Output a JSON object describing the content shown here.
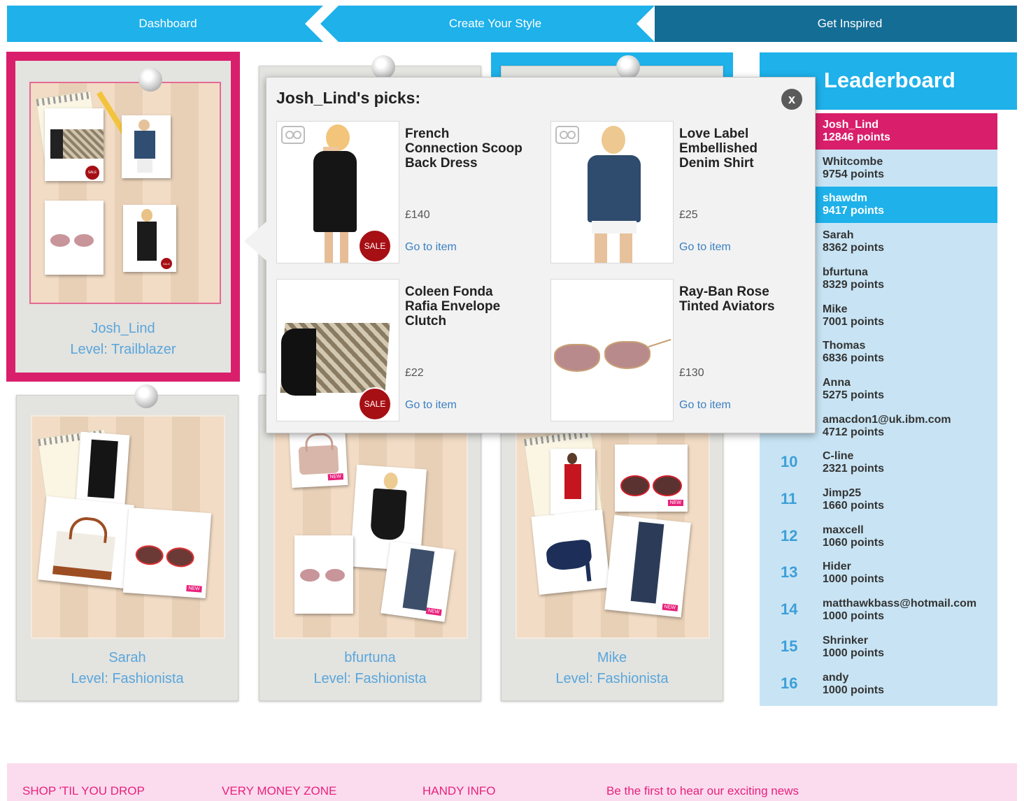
{
  "nav": {
    "tabs": [
      {
        "label": "Dashboard"
      },
      {
        "label": "Create Your Style"
      },
      {
        "label": "Get Inspired"
      }
    ]
  },
  "cards": [
    {
      "name": "Josh_Lind",
      "level": "Level: Trailblazer",
      "selected": true
    },
    {
      "name": "Sarah",
      "level": "Level: Fashionista"
    },
    {
      "name": "bfurtuna",
      "level": "Level: Fashionista"
    },
    {
      "name": "Mike",
      "level": "Level: Fashionista"
    }
  ],
  "popup": {
    "title": "Josh_Lind's picks:",
    "close_label": "x",
    "products": [
      {
        "name": "French Connection Scoop Back Dress",
        "price": "£140",
        "link": "Go to item",
        "sale": "SALE"
      },
      {
        "name": "Love Label Embellished Denim Shirt",
        "price": "£25",
        "link": "Go to item"
      },
      {
        "name": "Coleen Fonda Rafia Envelope Clutch",
        "price": "£22",
        "link": "Go to item",
        "sale": "SALE"
      },
      {
        "name": "Ray-Ban Rose Tinted Aviators",
        "price": "£130",
        "link": "Go to item"
      }
    ]
  },
  "board_tags": {
    "sale": "SALE",
    "new": "NEW"
  },
  "leaderboard": {
    "title": "Leaderboard",
    "rows": [
      {
        "rank": "",
        "name": "Josh_Lind",
        "points": "12846 points",
        "highlight": "pink"
      },
      {
        "rank": "",
        "name": "Whitcombe",
        "points": "9754 points"
      },
      {
        "rank": "",
        "name": "shawdm",
        "points": "9417 points",
        "highlight": "blue"
      },
      {
        "rank": "",
        "name": "Sarah",
        "points": "8362 points"
      },
      {
        "rank": "",
        "name": "bfurtuna",
        "points": "8329 points"
      },
      {
        "rank": "",
        "name": "Mike",
        "points": "7001 points"
      },
      {
        "rank": "",
        "name": "Thomas",
        "points": "6836 points"
      },
      {
        "rank": "",
        "name": "Anna",
        "points": "5275 points"
      },
      {
        "rank": "",
        "name": "amacdon1@uk.ibm.com",
        "points": "4712 points"
      },
      {
        "rank": "10",
        "name": "C-line",
        "points": "2321 points"
      },
      {
        "rank": "11",
        "name": "Jimp25",
        "points": "1660 points"
      },
      {
        "rank": "12",
        "name": "maxcell",
        "points": "1060 points"
      },
      {
        "rank": "13",
        "name": "Hider",
        "points": "1000 points"
      },
      {
        "rank": "14",
        "name": "matthawkbass@hotmail.com",
        "points": "1000 points"
      },
      {
        "rank": "15",
        "name": "Shrinker",
        "points": "1000 points"
      },
      {
        "rank": "16",
        "name": "andy",
        "points": "1000 points"
      }
    ]
  },
  "footer": {
    "links": [
      {
        "label": "SHOP 'TIL YOU DROP"
      },
      {
        "label": "VERY MONEY ZONE"
      },
      {
        "label": "HANDY INFO"
      },
      {
        "label": "Be the first to hear our exciting news"
      }
    ]
  },
  "colors": {
    "nav_blue": "#1eb1ea",
    "nav_dark": "#146d95",
    "accent_pink": "#d91f6b",
    "leaderboard_bg": "#c8e4f4",
    "footer_bg": "#fbdcef",
    "link_blue": "#5aa6dc"
  }
}
